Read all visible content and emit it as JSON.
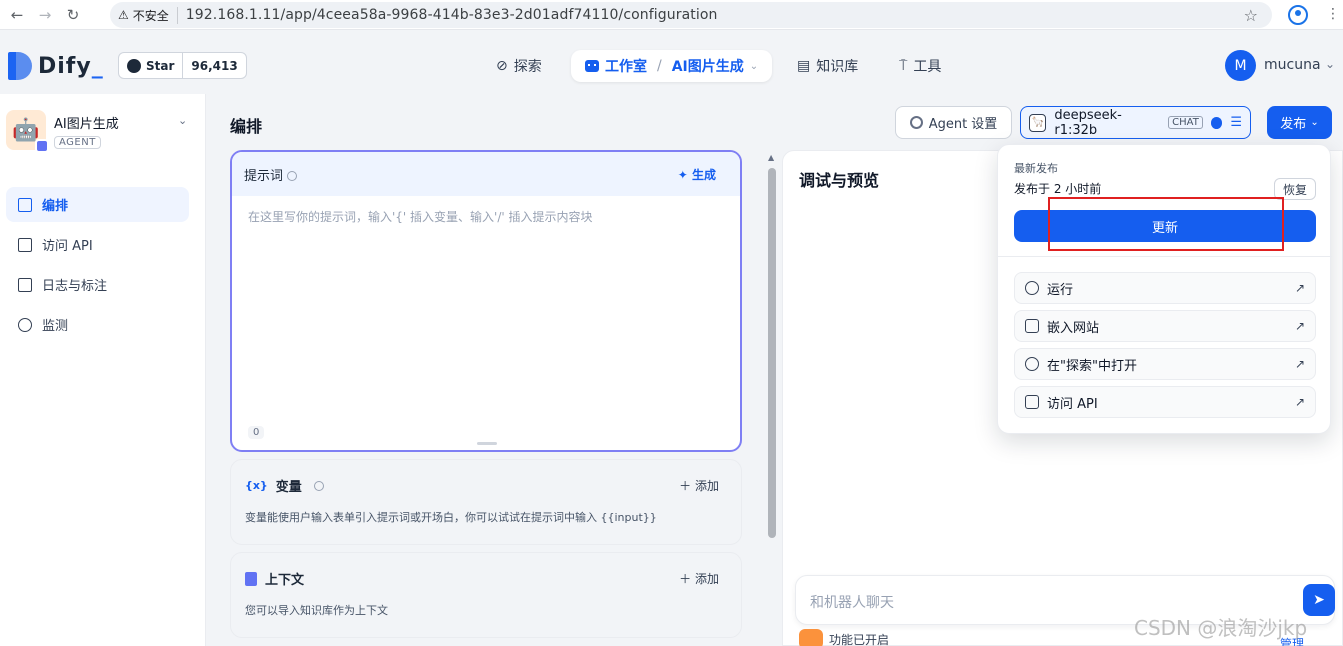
{
  "browser": {
    "back_icon": "arrow-left-icon",
    "insecure_label": "不安全",
    "url": "192.168.1.11/app/4ceea58a-9968-414b-83e3-2d01adf74110/configuration"
  },
  "header": {
    "logo_text": "Dify",
    "github_star_label": "Star",
    "github_star_count": "96,413",
    "nav": {
      "explore": "探索",
      "studio": "工作室",
      "separator": "/",
      "current_app": "AI图片生成",
      "knowledge": "知识库",
      "tools": "工具"
    },
    "user_initial": "M",
    "user_name": "mucuna"
  },
  "sidebar": {
    "app_name": "AI图片生成",
    "app_type": "AGENT",
    "items": [
      {
        "label": "编排",
        "icon": "layout-icon"
      },
      {
        "label": "访问 API",
        "icon": "terminal-icon"
      },
      {
        "label": "日志与标注",
        "icon": "file-list-icon"
      },
      {
        "label": "监测",
        "icon": "gauge-icon"
      }
    ]
  },
  "main": {
    "title": "编排",
    "agent_settings_label": "Agent 设置",
    "model_name": "deepseek-r1:32b",
    "model_tag": "CHAT",
    "publish_label": "发布",
    "prompt": {
      "label": "提示词",
      "generate_label": "生成",
      "placeholder": "在这里写你的提示词，输入'{' 插入变量、输入'/' 插入提示内容块",
      "count": "0"
    },
    "variables": {
      "title": "变量",
      "add_label": "添加",
      "description": "变量能使用户输入表单引入提示词或开场白，你可以试试在提示词中输入 {{input}}"
    },
    "context": {
      "title": "上下文",
      "add_label": "添加",
      "description": "您可以导入知识库作为上下文"
    }
  },
  "debug": {
    "title": "调试与预览",
    "chat_placeholder": "和机器人聊天",
    "feature_label": "功能已开启",
    "manage_label": "管理"
  },
  "publish_dropdown": {
    "latest_label": "最新发布",
    "published_time": "发布于 2 小时前",
    "restore_label": "恢复",
    "update_label": "更新",
    "items": [
      {
        "label": "运行",
        "icon": "play-circle-icon"
      },
      {
        "label": "嵌入网站",
        "icon": "embed-icon"
      },
      {
        "label": "在\"探索\"中打开",
        "icon": "compass-icon"
      },
      {
        "label": "访问 API",
        "icon": "document-icon"
      }
    ]
  },
  "watermark": "CSDN @浪淘沙jkp"
}
